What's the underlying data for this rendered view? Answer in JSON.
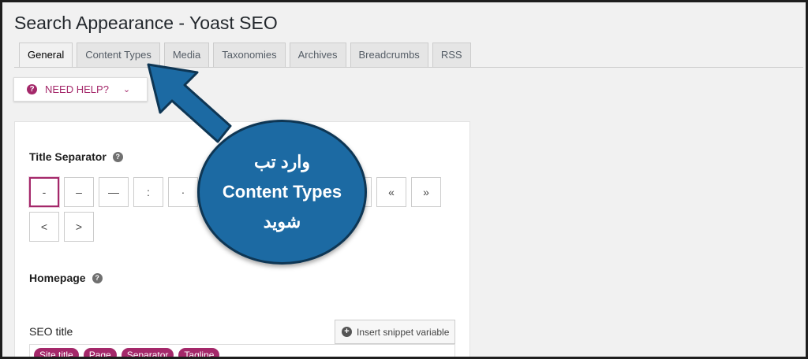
{
  "page_title": "Search Appearance - Yoast SEO",
  "tabs": [
    {
      "label": "General",
      "active": true
    },
    {
      "label": "Content Types",
      "active": false
    },
    {
      "label": "Media",
      "active": false
    },
    {
      "label": "Taxonomies",
      "active": false
    },
    {
      "label": "Archives",
      "active": false
    },
    {
      "label": "Breadcrumbs",
      "active": false
    },
    {
      "label": "RSS",
      "active": false
    }
  ],
  "help_button": {
    "label": "NEED HELP?",
    "icon": "question-circle-icon"
  },
  "title_separator": {
    "label": "Title Separator",
    "options": [
      "-",
      "–",
      "—",
      ":",
      "·",
      "»",
      "«",
      "<",
      ">"
    ],
    "selected": "-"
  },
  "homepage": {
    "label": "Homepage"
  },
  "seo_title": {
    "label": "SEO title",
    "insert_button": "Insert snippet variable",
    "variables": [
      "Site title",
      "Page",
      "Separator",
      "Tagline"
    ]
  },
  "callout": {
    "line1": "وارد تب",
    "line2": "Content Types",
    "line3": "شوید"
  },
  "colors": {
    "accent": "#a4286a",
    "callout": "#1c6aa3",
    "callout_border": "#0e3654"
  }
}
